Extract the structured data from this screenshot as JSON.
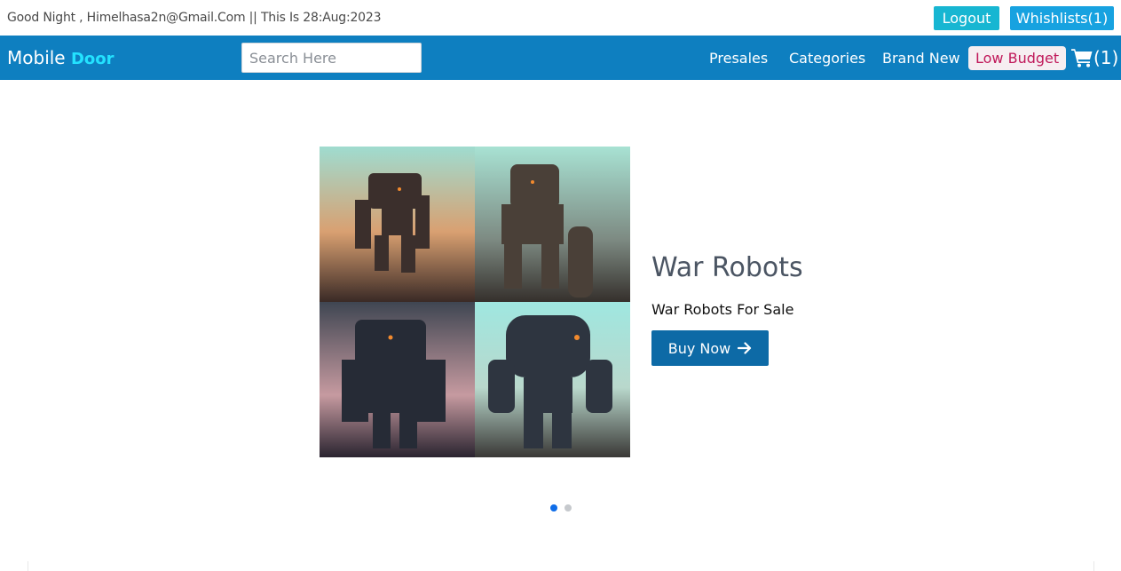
{
  "topbar": {
    "greeting": "Good Night , Himelhasa2n@Gmail.Com || This Is 28:Aug:2023",
    "logout_label": "Logout",
    "wishlist_label": "Whishlists(1)"
  },
  "navbar": {
    "brand_main": "Mobile ",
    "brand_accent": "Door",
    "search_placeholder": "Search Here",
    "links": [
      "Presales",
      "Categories",
      "Brand New"
    ],
    "low_budget_label": "Low Budget",
    "cart_count": "(1)"
  },
  "hero": {
    "title": "War Robots",
    "subtitle": "War Robots For Sale",
    "button_label": "Buy Now",
    "slide_count": 2,
    "active_slide": 1
  },
  "colors": {
    "navbar": "#0e7fc0",
    "brand_accent": "#23e2ff",
    "logout": "#17b6d2",
    "wishlist": "#17a2e0",
    "low_budget_text": "#c0195a",
    "buy_button": "#0d6aa6",
    "active_dot": "#0f6de8"
  },
  "icons": {
    "cart": "shopping-cart-icon",
    "buy_arrow": "arrow-right-icon"
  }
}
